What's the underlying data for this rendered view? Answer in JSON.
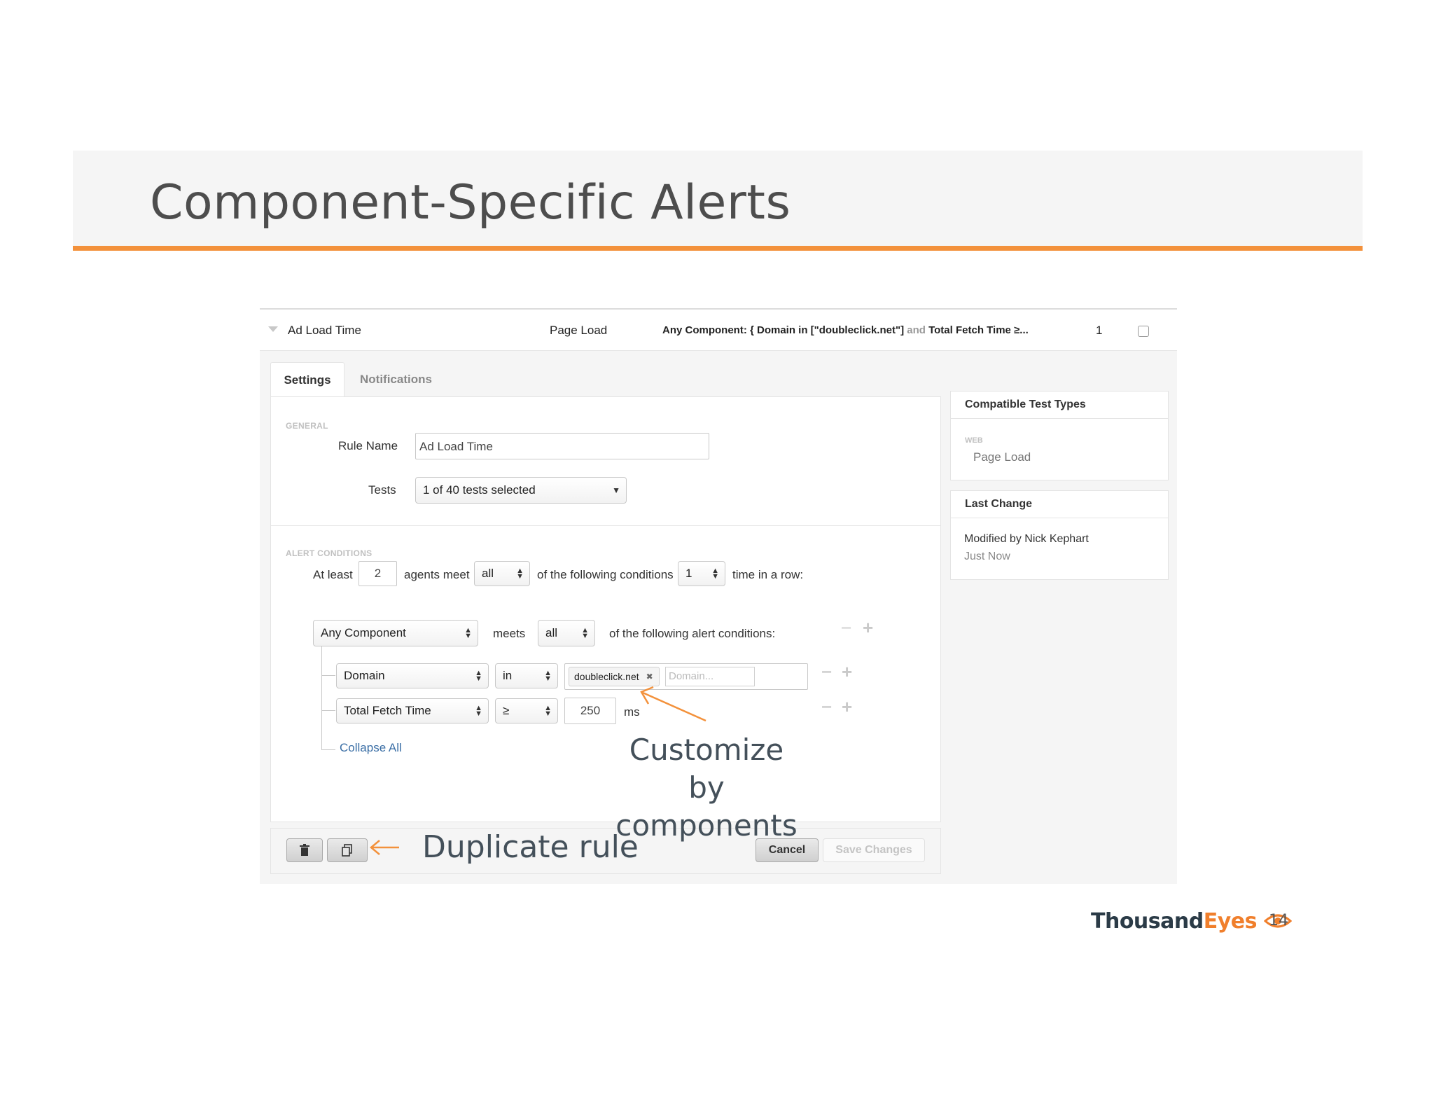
{
  "slide": {
    "title": "Component-Specific Alerts",
    "page_number": "14"
  },
  "rule_row": {
    "name": "Ad Load Time",
    "test_type": "Page Load",
    "condition_part1": "Any Component: { Domain in [\"doubleclick.net\"]",
    "condition_and": "and",
    "condition_part2": "Total Fetch Time ≥...",
    "count": "1"
  },
  "tabs": {
    "settings": "Settings",
    "notifications": "Notifications"
  },
  "general": {
    "section_label": "GENERAL",
    "rule_name_label": "Rule Name",
    "rule_name_value": "Ad Load Time",
    "tests_label": "Tests",
    "tests_value": "1 of 40 tests selected"
  },
  "alert_conditions": {
    "section_label": "ALERT CONDITIONS",
    "at_least": "At least",
    "agents_value": "2",
    "agents_meet": "agents meet",
    "all_value": "all",
    "following_conditions": "of the following conditions",
    "times_value": "1",
    "time_in_row": "time in a row:",
    "component_value": "Any Component",
    "meets": "meets",
    "meets_all_value": "all",
    "following_alert_conditions": "of the following alert conditions:",
    "cond1_metric": "Domain",
    "cond1_op": "in",
    "cond1_token": "doubleclick.net",
    "cond1_placeholder": "Domain...",
    "cond2_metric": "Total Fetch Time",
    "cond2_op": "≥",
    "cond2_value": "250",
    "cond2_unit": "ms",
    "collapse_all": "Collapse All"
  },
  "sidebar": {
    "compatible_title": "Compatible Test Types",
    "web_label": "WEB",
    "page_load": "Page Load",
    "last_change_title": "Last Change",
    "modified_by": "Modified by Nick Kephart",
    "just_now": "Just Now"
  },
  "footer": {
    "cancel": "Cancel",
    "save": "Save Changes"
  },
  "annotations": {
    "customize_line1": "Customize by",
    "customize_line2": "components",
    "duplicate_rule": "Duplicate rule"
  },
  "logo": {
    "part1": "Thousand",
    "part2": "Eyes"
  },
  "colors": {
    "accent": "#f3913b",
    "link": "#3a6ea5",
    "brand_dark": "#2b3b47",
    "brand_orange": "#f07f2c"
  },
  "icons": [
    "trash-icon",
    "duplicate-icon",
    "eye-icon"
  ]
}
